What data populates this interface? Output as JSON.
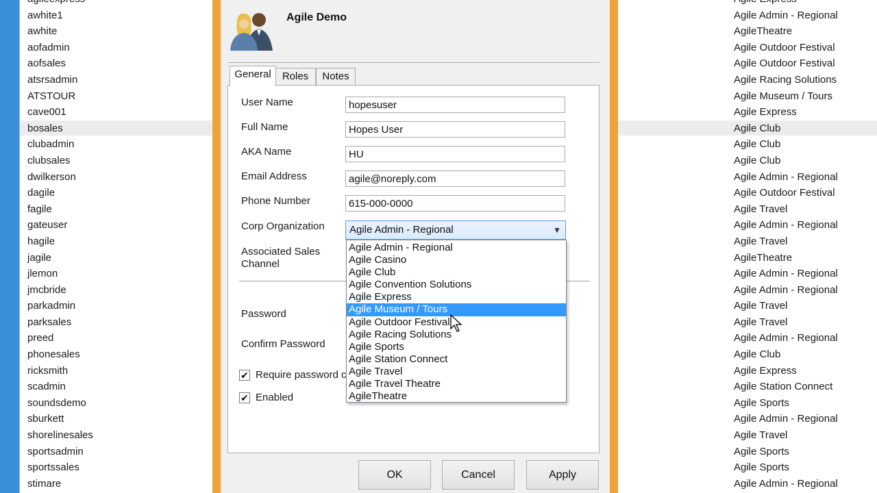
{
  "users": [
    "agileexpress",
    "awhite1",
    "awhite",
    "aofadmin",
    "aofsales",
    "atsrsadmin",
    "ATSTOUR",
    "cave001",
    "bosales",
    "clubadmin",
    "clubsales",
    "dwilkerson",
    "dagile",
    "fagile",
    "gateuser",
    "hagile",
    "jagile",
    "jlemon",
    "jmcbride",
    "parkadmin",
    "parksales",
    "preed",
    "phonesales",
    "ricksmith",
    "scadmin",
    "soundsdemo",
    "sburkett",
    "shorelinesales",
    "sportsadmin",
    "sportssales",
    "stimare"
  ],
  "orgs": [
    "Agile Express",
    "Agile Admin - Regional",
    "AgileTheatre",
    "Agile Outdoor Festival",
    "Agile Outdoor Festival",
    "Agile Racing Solutions",
    "Agile Museum / Tours",
    "Agile Express",
    "Agile Club",
    "Agile Club",
    "Agile Club",
    "Agile Admin - Regional",
    "Agile Outdoor Festival",
    "Agile Travel",
    "Agile Admin - Regional",
    "Agile Travel",
    "AgileTheatre",
    "Agile Admin - Regional",
    "Agile Admin - Regional",
    "Agile Travel",
    "Agile Travel",
    "Agile Admin - Regional",
    "Agile Club",
    "Agile Express",
    "Agile Station Connect",
    "Agile Sports",
    "Agile Admin - Regional",
    "Agile Travel",
    "Agile Sports",
    "Agile Sports",
    "Agile Admin - Regional"
  ],
  "dialog": {
    "title": "Agile Demo",
    "tabs": [
      "General",
      "Roles",
      "Notes"
    ],
    "labels": {
      "user_name": "User Name",
      "full_name": "Full Name",
      "aka_name": "AKA Name",
      "email": "Email Address",
      "phone": "Phone Number",
      "corp_org": "Corp Organization",
      "assoc_sales_1": "Associated Sales",
      "assoc_sales_2": "Channel",
      "password": "Password",
      "confirm_password": "Confirm Password",
      "require_password": "Require password c",
      "enabled": "Enabled"
    },
    "values": {
      "user_name": "hopesuser",
      "full_name": "Hopes User",
      "aka_name": "HU",
      "email": "agile@noreply.com",
      "phone": "615-000-0000",
      "corp_org": "Agile Admin - Regional"
    },
    "checkboxes": {
      "require_password": true,
      "enabled": true
    },
    "check_glyph": "✔",
    "dropdown_options": [
      "Agile Admin - Regional",
      "Agile Casino",
      "Agile Club",
      "Agile Convention Solutions",
      "Agile Express",
      "Agile Museum / Tours",
      "Agile Outdoor Festival",
      "Agile Racing Solutions",
      "Agile Sports",
      "Agile Station Connect",
      "Agile Travel",
      "Agile Travel Theatre",
      "AgileTheatre"
    ],
    "dropdown_highlighted": "Agile Museum / Tours",
    "buttons": {
      "ok": "OK",
      "cancel": "Cancel",
      "apply": "Apply"
    }
  },
  "colors": {
    "highlight": "#3399ff",
    "dialog_border": "#f0a23a",
    "desktop": "#3b8fd6"
  }
}
